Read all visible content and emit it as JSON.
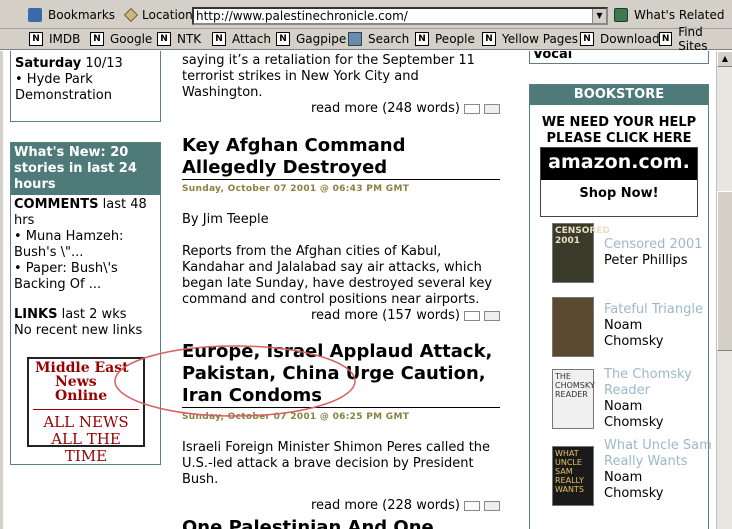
{
  "toolbar": {
    "bookmarks": "Bookmarks",
    "location_label": "Location:",
    "url": "http://www.palestinechronicle.com/",
    "whats_related": "What's Related"
  },
  "personal_toolbar": [
    "IMDB",
    "Google",
    "NTK",
    "Attach",
    "Gagpipe",
    "Search",
    "People",
    "Yellow Pages",
    "Download",
    "Find Sites"
  ],
  "left": {
    "calendar_day": "Saturday",
    "calendar_date": "10/13",
    "calendar_item": "• Hyde Park Demonstration",
    "whats_new_title": "What's New: 20 stories in last 24 hours",
    "comments_label": "COMMENTS",
    "comments_span": "last 48 hrs",
    "comment_1": "• Muna Hamzeh: Bush's \\\"...",
    "comment_2": "• Paper: Bush\\'s Backing Of ...",
    "links_label": "LINKS",
    "links_span": "last 2 wks",
    "links_status": "No recent new links",
    "ad_title_1": "Middle East",
    "ad_title_2": "News Online",
    "ad_tagline_1": "ALL NEWS",
    "ad_tagline_2": "ALL THE TIME"
  },
  "articles": [
    {
      "intro": "saying it’s a retaliation for the September 11 terrorist strikes in New York City and Washington.",
      "read_more": "read more (248 words)"
    },
    {
      "title": "Key Afghan Command Allegedly Destroyed",
      "date": "Sunday, October 07 2001 @ 06:43 PM GMT",
      "byline": "By Jim Teeple",
      "body": "Reports from the Afghan cities of Kabul, Kandahar and Jalalabad say air attacks, which began late Sunday, have destroyed several key command and control positions near airports.",
      "read_more": "read more (157 words)"
    },
    {
      "title": "Europe, Israel Applaud Attack, Pakistan, China Urge Caution, Iran Condoms",
      "date": "Sunday, October 07 2001 @ 06:25 PM GMT",
      "body": "Israeli Foreign Minister Shimon Peres called the U.S.-led attack a brave decision by President Bush.",
      "read_more": "read more (228 words)"
    },
    {
      "title": "One Palestinian And One"
    }
  ],
  "right": {
    "top_label": "Vocal",
    "bookstore_title": "BOOKSTORE",
    "help_line1": "WE NEED YOUR HELP",
    "help_line2": "PLEASE CLICK HERE",
    "amazon": "amazon.com.",
    "shop_now": "Shop Now!",
    "books": [
      {
        "title": "Censored 2001",
        "author": "Peter Phillips",
        "cover_text": "CENSORED 2001"
      },
      {
        "title": "Fateful Triangle",
        "author": "Noam Chomsky",
        "cover_text": ""
      },
      {
        "title": "The Chomsky Reader",
        "author": "Noam Chomsky",
        "cover_text": "THE CHOMSKY READER"
      },
      {
        "title": "What Uncle Sam Really Wants",
        "author": "Noam Chomsky",
        "cover_text": "WHAT UNCLE SAM REALLY WANTS"
      }
    ]
  }
}
